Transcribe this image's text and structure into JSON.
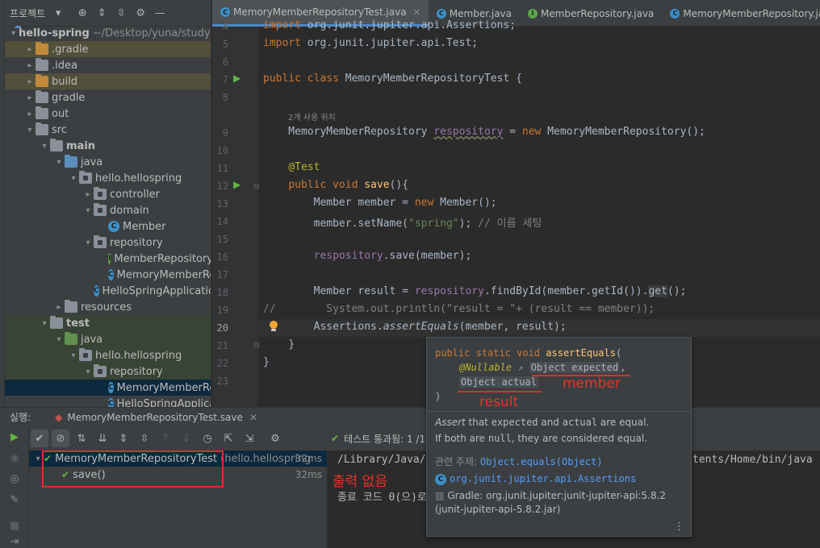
{
  "project_panel": {
    "title": "프로젝트",
    "tree": [
      {
        "label": "hello-spring",
        "extra": "~/Desktop/yuna/study/",
        "icon": "module-folder-icon"
      },
      {
        "label": ".gradle"
      },
      {
        "label": ".idea"
      },
      {
        "label": "build"
      },
      {
        "label": "gradle"
      },
      {
        "label": "out"
      },
      {
        "label": "src"
      },
      {
        "label": "main"
      },
      {
        "label": "java"
      },
      {
        "label": "hello.hellospring"
      },
      {
        "label": "controller"
      },
      {
        "label": "domain"
      },
      {
        "label": "Member"
      },
      {
        "label": "repository"
      },
      {
        "label": "MemberRepository"
      },
      {
        "label": "MemoryMemberRepository"
      },
      {
        "label": "HelloSpringApplication"
      },
      {
        "label": "resources"
      },
      {
        "label": "test"
      },
      {
        "label": "java"
      },
      {
        "label": "hello.hellospring"
      },
      {
        "label": "repository"
      },
      {
        "label": "MemoryMemberRepositoryTest"
      },
      {
        "label": "HelloSpringApplicationTests"
      }
    ]
  },
  "editor": {
    "tabs": [
      {
        "label": "MemoryMemberRepositoryTest.java",
        "active": true
      },
      {
        "label": "Member.java"
      },
      {
        "label": "MemberRepository.java"
      },
      {
        "label": "MemoryMemberRepository.java"
      }
    ],
    "line_numbers": [
      "4",
      "5",
      "6",
      "7",
      "8",
      "",
      "9",
      "10",
      "11",
      "12",
      "13",
      "14",
      "15",
      "16",
      "17",
      "18",
      "19",
      "20",
      "21",
      "22",
      "23"
    ],
    "usage_hint": "2개 사용 위치"
  },
  "run_panel": {
    "label": "실행:",
    "tab": "MemoryMemberRepositoryTest.save",
    "status": "테스트 통과됨: 1 /1",
    "tests": [
      {
        "name": "MemoryMemberRepositoryTest",
        "pkg": "(hello.hellospring",
        "time": "32ms"
      },
      {
        "name": "save()",
        "time": "32ms"
      }
    ],
    "console_line1_left": "/Library/Java/",
    "console_line1_right": "tents/Home/bin/java",
    "console_line2": "종료 코드 0(으)로"
  },
  "annotations": {
    "no_output": "출력 없음",
    "member": "member",
    "result": "result"
  },
  "popup": {
    "sig_line1_kw": "public static void ",
    "sig_line1_fn": "assertEquals",
    "sig_line1_paren": "(",
    "sig_ann": "@Nullable",
    "sig_param1": "Object expected",
    "sig_param2": "Object actual",
    "sig_close": ")",
    "doc1_a": "Assert",
    "doc1_b": " that ",
    "doc1_c": "expected",
    "doc1_d": " and ",
    "doc1_e": "actual",
    "doc1_f": " are equal.",
    "doc2_a": "If both are ",
    "doc2_b": "null",
    "doc2_c": ", they are considered equal.",
    "related_label": "관련 주제:",
    "related_link": "Object.equals(Object)",
    "class_link": "org.junit.jupiter.api.Assertions",
    "gradle1": "Gradle: org.junit.jupiter:junit-jupiter-api:5.8.2",
    "gradle2": "(junit-jupiter-api-5.8.2.jar)"
  },
  "colors": {
    "accent": "#4a88c7",
    "annotation_red": "#e22b2b",
    "pass_green": "#62b543"
  }
}
